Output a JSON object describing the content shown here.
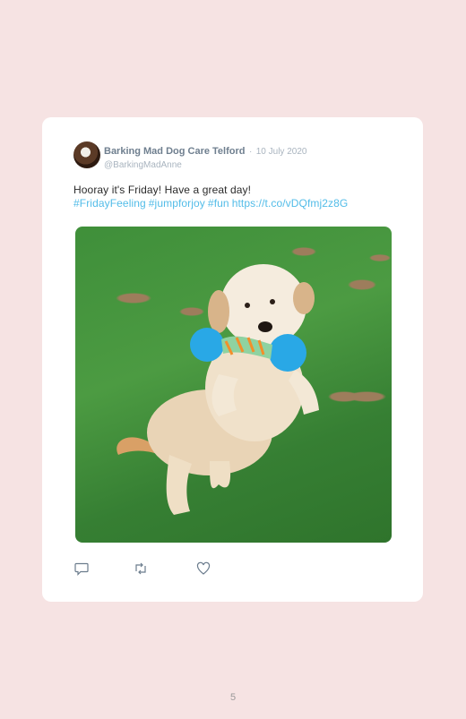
{
  "tweet": {
    "author": {
      "display_name": "Barking Mad Dog Care Telford",
      "handle": "@BarkingMadAnne",
      "avatar_icon": "profile-photo"
    },
    "separator": "·",
    "date": "10 July 2020",
    "text": "Hooray it's Friday! Have a great day!",
    "hashtags": [
      "#FridayFeeling",
      "#jumpforjoy",
      "#fun"
    ],
    "link": "https://t.co/vDQfmj2z8G",
    "actions": {
      "reply_icon": "reply-icon",
      "retweet_icon": "retweet-icon",
      "like_icon": "heart-icon"
    }
  },
  "page": {
    "number": "5"
  },
  "colors": {
    "background": "#f6e3e3",
    "card": "#ffffff",
    "link": "#52bce8",
    "name": "#6f7f8f",
    "muted": "#a9b4bf"
  }
}
